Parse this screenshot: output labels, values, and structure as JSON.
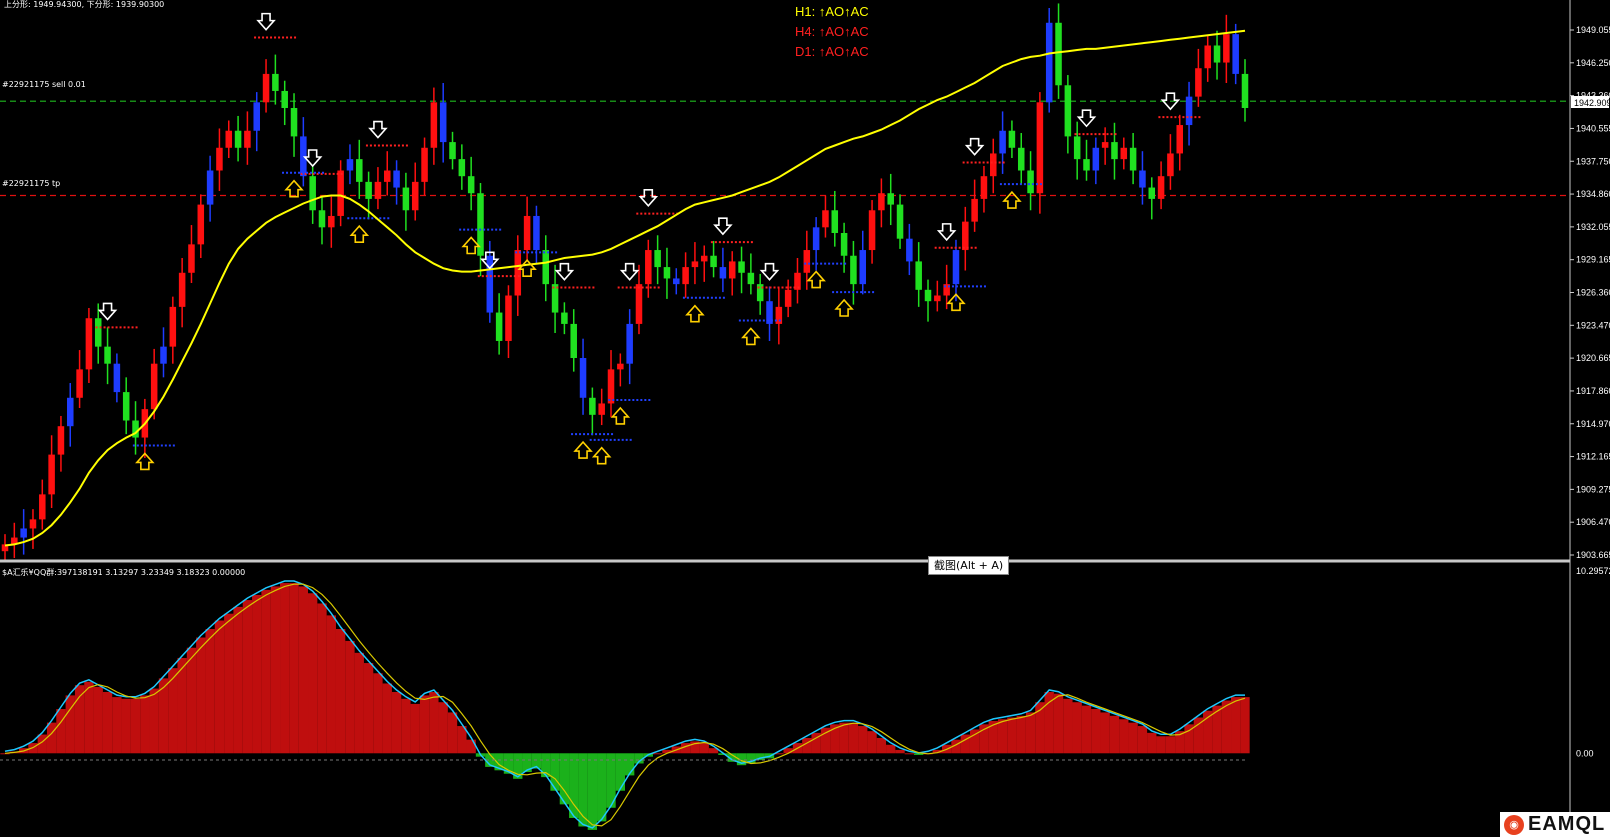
{
  "header": {
    "bands_text": "上分形: 1949.94300, 下分形: 1939.90300"
  },
  "indicator": {
    "h1": "H1: ↑AO↑AC",
    "h4": "H4: ↑AO↑AC",
    "d1": "D1: ↑AO↑AC",
    "colors": {
      "h1": "#ffff00",
      "h4": "#ff2020",
      "d1": "#ff2020"
    }
  },
  "levels": {
    "sell": {
      "label": "#22921175 sell 0.01",
      "price": 1943.6,
      "color": "#1fb81f"
    },
    "tp": {
      "label": "#22921175 tp",
      "price": 1935.3,
      "color": "#e01010"
    }
  },
  "price_axis": {
    "labels": [
      "1949.055",
      "1946.250",
      "1943.360",
      "1940.555",
      "1937.750",
      "1934.860",
      "1932.055",
      "1929.165",
      "1926.360",
      "1923.470",
      "1920.665",
      "1917.860",
      "1914.970",
      "1912.165",
      "1909.275",
      "1906.470",
      "1903.665"
    ],
    "current": "1942.909"
  },
  "sub_window": {
    "label": "$A汇乐¥QQ群:397138191 3.13297 3.23349 3.18323 0.00000",
    "max_label": "10.29572",
    "zero_label": "0.00"
  },
  "tooltip": "截图(Alt + A)",
  "logo": {
    "text": "EAMQL"
  },
  "chart_data": {
    "type": "line",
    "title": "",
    "main_ylim": [
      1903.665,
      1951.8
    ],
    "close": [
      1904.6,
      1905.2,
      1906.0,
      1906.8,
      1909.0,
      1912.5,
      1915.0,
      1917.5,
      1920.0,
      1924.5,
      1922.0,
      1920.5,
      1918.0,
      1915.5,
      1914.0,
      1916.5,
      1920.5,
      1922.0,
      1925.5,
      1928.5,
      1931.0,
      1934.5,
      1937.5,
      1939.5,
      1941.0,
      1939.5,
      1941.0,
      1943.5,
      1946.0,
      1944.5,
      1943.0,
      1940.5,
      1937.0,
      1934.0,
      1932.5,
      1933.5,
      1937.5,
      1938.5,
      1936.5,
      1935.0,
      1936.5,
      1937.5,
      1936.0,
      1934.0,
      1936.5,
      1939.5,
      1943.5,
      1940.0,
      1938.5,
      1937.0,
      1935.5,
      1930.0,
      1925.0,
      1922.5,
      1926.5,
      1930.5,
      1933.5,
      1930.5,
      1927.5,
      1925.0,
      1924.0,
      1921.0,
      1917.5,
      1916.0,
      1917.0,
      1920.0,
      1920.5,
      1924.0,
      1927.5,
      1930.5,
      1929.0,
      1928.0,
      1927.5,
      1929.0,
      1929.5,
      1930.0,
      1929.0,
      1928.0,
      1929.5,
      1928.5,
      1927.5,
      1926.0,
      1924.0,
      1925.5,
      1927.0,
      1928.5,
      1930.5,
      1932.5,
      1934.0,
      1932.0,
      1930.0,
      1927.5,
      1930.5,
      1934.0,
      1935.5,
      1934.5,
      1931.5,
      1929.5,
      1927.0,
      1926.0,
      1926.5,
      1927.5,
      1930.5,
      1933.0,
      1935.0,
      1937.0,
      1939.0,
      1941.0,
      1939.5,
      1937.5,
      1935.5,
      1943.5,
      1950.5,
      1945.0,
      1940.5,
      1938.5,
      1937.5,
      1939.5,
      1940.0,
      1938.5,
      1939.5,
      1937.5,
      1936.0,
      1935.0,
      1937.0,
      1939.0,
      1941.5,
      1944.0,
      1946.5,
      1948.5,
      1947.0,
      1949.5,
      1946.0,
      1943.0
    ],
    "ma": [
      1904.5,
      1904.6,
      1904.8,
      1905.1,
      1905.6,
      1906.3,
      1907.2,
      1908.3,
      1909.5,
      1910.9,
      1912.0,
      1912.9,
      1913.5,
      1914.0,
      1914.4,
      1915.2,
      1916.3,
      1917.6,
      1919.1,
      1920.7,
      1922.3,
      1924.0,
      1925.8,
      1927.6,
      1929.3,
      1930.6,
      1931.5,
      1932.2,
      1932.9,
      1933.4,
      1933.8,
      1934.2,
      1934.6,
      1934.9,
      1935.2,
      1935.3,
      1935.3,
      1935.0,
      1934.5,
      1933.9,
      1933.2,
      1932.5,
      1931.8,
      1931.0,
      1930.3,
      1929.8,
      1929.3,
      1928.9,
      1928.7,
      1928.6,
      1928.6,
      1928.7,
      1928.8,
      1928.9,
      1929.0,
      1929.1,
      1929.2,
      1929.3,
      1929.4,
      1929.6,
      1929.8,
      1929.9,
      1930.0,
      1930.1,
      1930.3,
      1930.6,
      1931.0,
      1931.4,
      1931.8,
      1932.2,
      1932.6,
      1933.1,
      1933.6,
      1934.1,
      1934.5,
      1934.7,
      1934.9,
      1935.1,
      1935.3,
      1935.6,
      1935.9,
      1936.2,
      1936.5,
      1936.9,
      1937.4,
      1937.9,
      1938.4,
      1938.9,
      1939.4,
      1939.7,
      1940.0,
      1940.3,
      1940.5,
      1940.8,
      1941.1,
      1941.5,
      1941.9,
      1942.4,
      1942.9,
      1943.3,
      1943.7,
      1944.0,
      1944.4,
      1944.8,
      1945.2,
      1945.7,
      1946.2,
      1946.7,
      1947.0,
      1947.3,
      1947.5,
      1947.6,
      1947.8,
      1947.9,
      1948.0,
      1948.1,
      1948.2,
      1948.2,
      1948.3,
      1948.4,
      1948.5,
      1948.6,
      1948.7,
      1948.8,
      1948.9,
      1949.0,
      1949.1,
      1949.2,
      1949.3,
      1949.4,
      1949.5,
      1949.6,
      1949.7,
      1949.8
    ],
    "histogram": [
      0.0,
      0.1,
      0.3,
      0.6,
      1.1,
      1.8,
      2.6,
      3.4,
      4.0,
      4.2,
      3.9,
      3.6,
      3.3,
      3.2,
      3.2,
      3.4,
      3.8,
      4.4,
      5.0,
      5.6,
      6.2,
      6.8,
      7.3,
      7.8,
      8.2,
      8.6,
      9.0,
      9.3,
      9.6,
      9.8,
      10.0,
      10.0,
      9.8,
      9.4,
      8.8,
      8.1,
      7.3,
      6.6,
      5.9,
      5.3,
      4.7,
      4.1,
      3.6,
      3.2,
      2.9,
      3.4,
      3.6,
      3.0,
      2.4,
      1.6,
      0.8,
      -0.2,
      -0.8,
      -1.0,
      -1.2,
      -1.5,
      -1.1,
      -0.9,
      -1.4,
      -2.2,
      -3.0,
      -3.8,
      -4.3,
      -4.5,
      -4.0,
      -3.2,
      -2.2,
      -1.3,
      -0.6,
      -0.2,
      0.0,
      0.2,
      0.4,
      0.6,
      0.7,
      0.6,
      0.3,
      -0.1,
      -0.5,
      -0.7,
      -0.6,
      -0.4,
      -0.3,
      0.0,
      0.3,
      0.6,
      0.9,
      1.2,
      1.5,
      1.7,
      1.8,
      1.8,
      1.6,
      1.3,
      0.9,
      0.5,
      0.2,
      0.0,
      -0.1,
      0.0,
      0.2,
      0.5,
      0.8,
      1.1,
      1.4,
      1.7,
      1.9,
      2.0,
      2.1,
      2.2,
      2.4,
      3.0,
      3.6,
      3.5,
      3.2,
      3.0,
      2.8,
      2.6,
      2.4,
      2.2,
      2.0,
      1.8,
      1.6,
      1.2,
      1.0,
      1.0,
      1.3,
      1.7,
      2.1,
      2.5,
      2.8,
      3.1,
      3.3,
      3.3
    ],
    "sub_ylim": [
      -4.8,
      10.29572
    ],
    "down_arrows": [
      11,
      28,
      33,
      40,
      52,
      60,
      67,
      69,
      77,
      82,
      101,
      104,
      116,
      125
    ],
    "up_arrows": [
      15,
      31,
      38,
      50,
      56,
      62,
      64,
      66,
      74,
      80,
      87,
      90,
      102,
      108
    ]
  }
}
